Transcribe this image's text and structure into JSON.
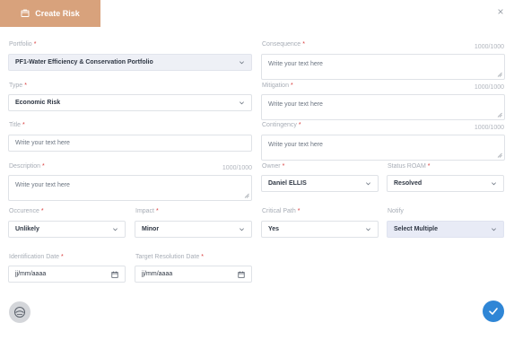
{
  "header": {
    "title": "Create Risk",
    "icon": "folder-icon",
    "accent": "#d8a27c"
  },
  "close_label": "×",
  "form": {
    "portfolio": {
      "label": "Portfolio",
      "value": "PF1-Water Efficiency & Conservation Portfolio"
    },
    "type": {
      "label": "Type",
      "value": "Economic Risk"
    },
    "title": {
      "label": "Title",
      "placeholder": "Write your text here"
    },
    "description": {
      "label": "Description",
      "placeholder": "Write your text here",
      "counter": "1000/1000"
    },
    "consequence": {
      "label": "Consequence",
      "placeholder": "Write your text here",
      "counter": "1000/1000"
    },
    "mitigation": {
      "label": "Mitigation",
      "placeholder": "Write your text here",
      "counter": "1000/1000"
    },
    "contingency": {
      "label": "Contingency",
      "placeholder": "Write your text here",
      "counter": "1000/1000"
    },
    "owner": {
      "label": "Owner",
      "value": "Daniel ELLIS"
    },
    "status_roam": {
      "label": "Status ROAM",
      "value": "Resolved"
    },
    "occurence": {
      "label": "Occurence",
      "value": "Unlikely"
    },
    "impact": {
      "label": "Impact",
      "value": "Minor"
    },
    "critical_path": {
      "label": "Critical Path",
      "value": "Yes"
    },
    "notify": {
      "label": "Notify",
      "value": "Select Multiple"
    },
    "identification_date": {
      "label": "Identification Date",
      "value": "jj/mm/aaaa"
    },
    "target_resolution_date": {
      "label": "Target Resolution Date",
      "value": "jj/mm/aaaa"
    },
    "required_marker": "*"
  },
  "colors": {
    "confirm": "#2f86d6",
    "required": "#d93b3b"
  }
}
